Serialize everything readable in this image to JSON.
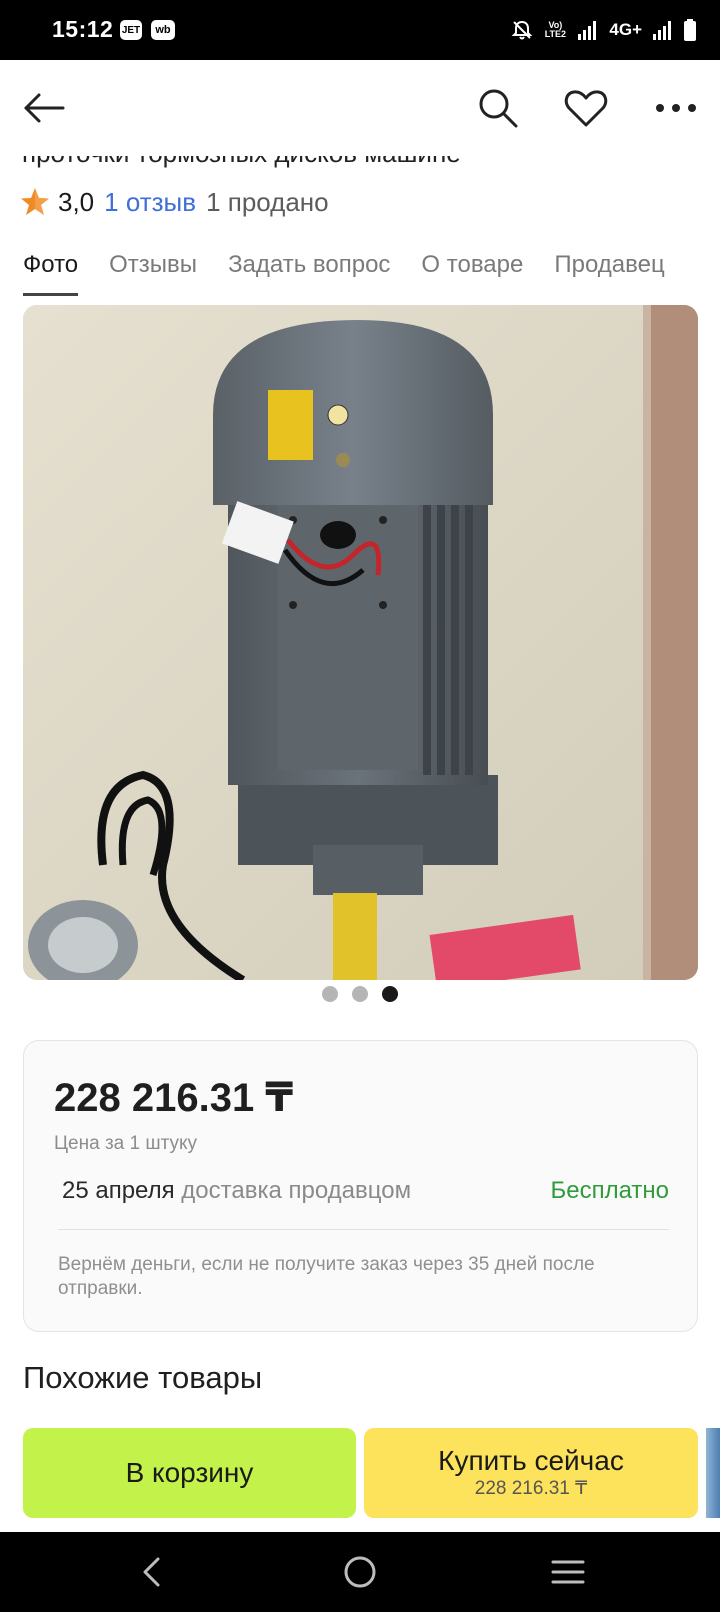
{
  "status_bar": {
    "time": "15:12",
    "badge_jet": "JET",
    "badge_wb": "wb",
    "volte": "Vo) LTE2",
    "network": "4G+"
  },
  "product": {
    "title_partial": "проточки тормозных дисков машине",
    "rating": "3,0",
    "reviews": "1 отзыв",
    "sold": "1 продано"
  },
  "tabs": [
    {
      "label": "Фото",
      "active": true
    },
    {
      "label": "Отзывы"
    },
    {
      "label": "Задать вопрос"
    },
    {
      "label": "О товаре"
    },
    {
      "label": "Продавец"
    }
  ],
  "gallery": {
    "total": 3,
    "active_index": 2,
    "image_icon": "electric-motor-photo"
  },
  "price_card": {
    "price": "228 216.31 ₸",
    "price_note": "Цена за 1 штуку",
    "delivery_date": "25 апреля",
    "delivery_method": "доставка продавцом",
    "delivery_cost": "Бесплатно",
    "refund_note": "Вернём деньги, если не получите заказ через 35 дней после отправки."
  },
  "similar_title": "Похожие товары",
  "actions": {
    "cart": "В корзину",
    "buy": "Купить сейчас",
    "buy_price": "228 216.31 ₸"
  },
  "colors": {
    "accent_link": "#3f6fd8",
    "cart_button": "#c3f24a",
    "buy_button": "#fde25c",
    "free_green": "#2e9c3a",
    "star": "#f08a24"
  }
}
